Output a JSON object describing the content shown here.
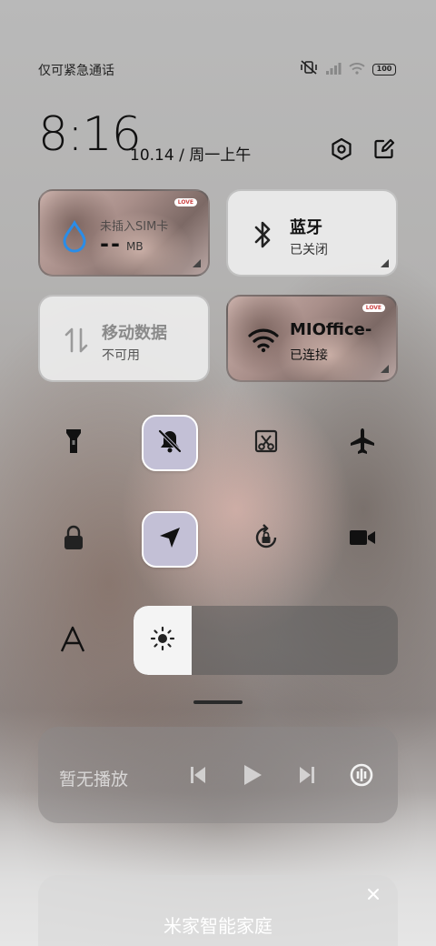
{
  "status_bar": {
    "carrier_text": "仅可紧急通话",
    "battery": "100"
  },
  "header": {
    "time": "8:16",
    "date": "10.14 / 周一上午"
  },
  "tiles": {
    "sim": {
      "title": "未插入SIM卡",
      "value": "--",
      "unit": "MB",
      "tag": "LOVE"
    },
    "bluetooth": {
      "title": "蓝牙",
      "status": "已关闭"
    },
    "mobile_data": {
      "title": "移动数据",
      "status": "不可用"
    },
    "wifi": {
      "title": "MIOffice-",
      "status": "已连接",
      "tag": "LOVE"
    }
  },
  "toggles": [
    {
      "name": "flashlight-icon",
      "active": false
    },
    {
      "name": "mute-bell-icon",
      "active": true
    },
    {
      "name": "screenshot-icon",
      "active": false
    },
    {
      "name": "airplane-icon",
      "active": false
    },
    {
      "name": "lock-icon",
      "active": false
    },
    {
      "name": "location-icon",
      "active": true
    },
    {
      "name": "rotation-lock-icon",
      "active": false
    },
    {
      "name": "video-camera-icon",
      "active": false
    }
  ],
  "brightness": {
    "level_percent": 22
  },
  "media": {
    "status": "暂无播放"
  },
  "smart_home": {
    "title": "米家智能家庭"
  },
  "colors": {
    "active_toggle": "#c3c0d6",
    "wifi_fill": "#111111"
  }
}
